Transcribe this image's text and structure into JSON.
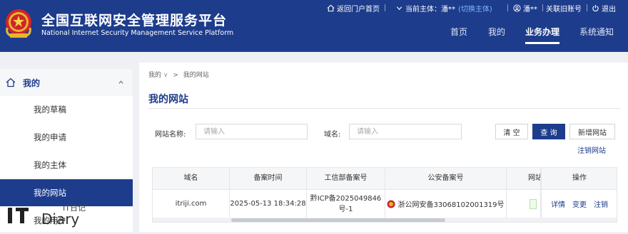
{
  "header": {
    "title_cn": "全国互联网安全管理服务平台",
    "title_en": "National Internet Security Management Service Platform",
    "return_portal": "返回门户首页",
    "current_subject_label": "当前主体：",
    "current_subject_value": "潘**",
    "switch_subject": "(切换主体)",
    "user_name": "潘**",
    "link_old_account": "关联旧账号",
    "logout": "退出",
    "nav": [
      "首页",
      "我的",
      "业务办理",
      "系统通知"
    ],
    "active_nav": "业务办理"
  },
  "sidebar": {
    "group_label": "我的",
    "items": [
      "我的草稿",
      "我的申请",
      "我的主体",
      "我的网站",
      "我的用户"
    ],
    "active_item": "我的网站"
  },
  "breadcrumb": {
    "root": "我的",
    "separator": ">",
    "current": "我的网站"
  },
  "page_title": "我的网站",
  "filters": {
    "site_name_label": "网站名称:",
    "site_name_placeholder": "请输入",
    "domain_label": "域名:",
    "domain_placeholder": "请输入"
  },
  "buttons": {
    "clear": "清 空",
    "query": "查 询",
    "add_site": "新增网站",
    "cancel_site": "注销网站"
  },
  "table": {
    "columns": [
      "域名",
      "备案时间",
      "工信部备案号",
      "公安备案号",
      "网站",
      "操作"
    ],
    "rows": [
      {
        "domain": "itriji.com",
        "filing_time": "2025-05-13 18:34:28",
        "miit_no_line1": "黔ICP备2025049846",
        "miit_no_line2": "号-1",
        "police_no": "浙公网安备33068102001319号",
        "actions": [
          "详情",
          "变更",
          "注销"
        ]
      }
    ]
  },
  "watermark": {
    "text_cn": "IT日记",
    "text_en": "Diary"
  },
  "colors": {
    "brand": "#1d3c8c",
    "accent_link": "#7fb8ff"
  }
}
